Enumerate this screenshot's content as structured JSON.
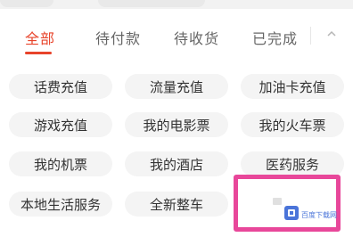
{
  "tabs": [
    {
      "label": "全部",
      "active": true
    },
    {
      "label": "待付款",
      "active": false
    },
    {
      "label": "待收货",
      "active": false
    },
    {
      "label": "已完成",
      "active": false
    }
  ],
  "services": [
    [
      "话费充值",
      "流量充值",
      "加油卡充值"
    ],
    [
      "游戏充值",
      "我的电影票",
      "我的火车票"
    ],
    [
      "我的机票",
      "我的酒店",
      "医药服务"
    ],
    [
      "本地生活服务",
      "全新整车",
      ""
    ]
  ],
  "watermark": {
    "text": "百度下载网"
  },
  "colors": {
    "accent": "#e8432a",
    "chip_bg": "#f4f4f4",
    "watermark_border": "#e8479a"
  },
  "icons": {
    "collapse": "chevron-up-icon"
  }
}
